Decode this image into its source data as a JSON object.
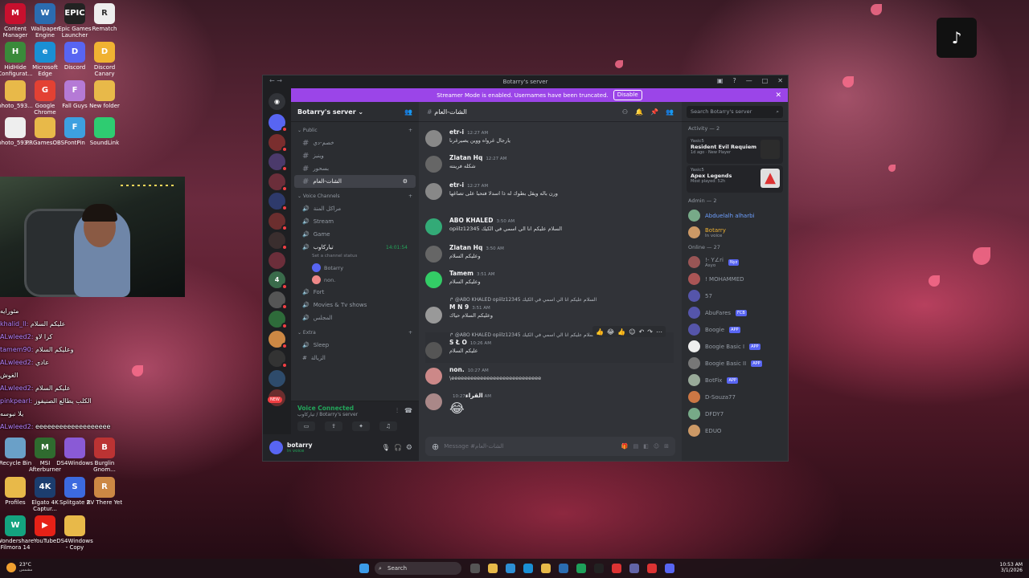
{
  "desktop": {
    "icons_top": [
      {
        "label": "Content Manager",
        "color": "#c8102e",
        "glyph": "M"
      },
      {
        "label": "Wallpaper Engine",
        "color": "#2b6cb0",
        "glyph": "W"
      },
      {
        "label": "Epic Games Launcher",
        "color": "#222",
        "glyph": "EPIC"
      },
      {
        "label": "Rematch",
        "color": "#eee",
        "glyph": "R"
      }
    ],
    "icons_row2": [
      {
        "label": "HidHide Configurat...",
        "color": "#3a8a3a",
        "glyph": "H"
      },
      {
        "label": "Microsoft Edge",
        "color": "#1a8fd4",
        "glyph": "e"
      },
      {
        "label": "Discord",
        "color": "#5865f2",
        "glyph": "D"
      },
      {
        "label": "Discord Canary",
        "color": "#f0b232",
        "glyph": "D"
      }
    ],
    "icons_row3": [
      {
        "label": "photo_593...",
        "color": "#e8b949",
        "glyph": ""
      },
      {
        "label": "Google Chrome",
        "color": "#e34133",
        "glyph": "G"
      },
      {
        "label": "Fall Guys",
        "color": "#b57ad6",
        "glyph": "F"
      },
      {
        "label": "New folder",
        "color": "#e8b949",
        "glyph": ""
      }
    ],
    "icons_row4": [
      {
        "label": "photo_593...",
        "color": "#eee",
        "glyph": ""
      },
      {
        "label": "PRGamesOBS",
        "color": "#e8b949",
        "glyph": ""
      },
      {
        "label": "FontPin",
        "color": "#3da0e0",
        "glyph": "F"
      },
      {
        "label": "SoundLink",
        "color": "#2ecc71",
        "glyph": ""
      }
    ],
    "icons_bottom": [
      {
        "label": "Recycle Bin",
        "color": "#6aa0c8",
        "glyph": ""
      },
      {
        "label": "MSI Afterburner",
        "color": "#2f6b2f",
        "glyph": "M"
      },
      {
        "label": "DS4Windows",
        "color": "#8a5ad6",
        "glyph": ""
      },
      {
        "label": "Burglin Gnom...",
        "color": "#b33",
        "glyph": "B"
      }
    ],
    "icons_bottom2": [
      {
        "label": "Profiles",
        "color": "#e8b949",
        "glyph": ""
      },
      {
        "label": "Elgato 4K Captur...",
        "color": "#1c3d6e",
        "glyph": "4K"
      },
      {
        "label": "Splitgate 2",
        "color": "#3c6adf",
        "glyph": "S"
      },
      {
        "label": "RV There Yet",
        "color": "#c84",
        "glyph": "R"
      }
    ],
    "icons_bottom3": [
      {
        "label": "Wondershare Filmora 14",
        "color": "#14a37f",
        "glyph": "W"
      },
      {
        "label": "YouTube",
        "color": "#e62117",
        "glyph": "▶"
      },
      {
        "label": "DS4Windows - Copy",
        "color": "#e8b949",
        "glyph": ""
      }
    ]
  },
  "stream_chat": [
    {
      "user": "",
      "text": "مثورايه"
    },
    {
      "user": "khalid_ll",
      "text": "عليكم السلام"
    },
    {
      "user": "ALwleed2",
      "text": "كرا لاو"
    },
    {
      "user": "tamem90",
      "text": "وعليكم السلام"
    },
    {
      "user": "ALwleed2",
      "text": "عادي"
    },
    {
      "user": "",
      "text": "الغوش"
    },
    {
      "user": "ALwleed2",
      "text": "عليكم السلام"
    },
    {
      "user": "pinkpearl",
      "text": "الكلب يطالع الصنيفوز"
    },
    {
      "user": "",
      "text": "يلا نبوسه"
    },
    {
      "user": "ALwleed2",
      "text": "eeeeeeeeeeeeeeeeeee"
    }
  ],
  "discord": {
    "window_title": "Botarry's server",
    "banner": {
      "text": "Streamer Mode is enabled. Usernames have been truncated.",
      "button": "Disable"
    },
    "server_name": "Botarry's server",
    "categories": {
      "public": "Public",
      "voice": "Voice Channels",
      "extra": "Extra"
    },
    "text_channels": [
      "خصم‑دي",
      "وينيز",
      "بسحور",
      "الشات‑العام"
    ],
    "voice_channels": [
      "مراكل المنة",
      "Stream",
      "Game",
      "تياركاوب",
      "Fort",
      "Movies & Tv shows",
      "المجلس"
    ],
    "voice_timer": "14:01:54",
    "voice_status_placeholder": "Set a channel status",
    "voice_users": [
      "Botarry",
      "non."
    ],
    "extra_channels": [
      "Sleep",
      "الزيالة"
    ],
    "new_badge": "NEW",
    "voice_connected": {
      "title": "Voice Connected",
      "subtitle": "تياركاوب / Botarry's server"
    },
    "user": {
      "name": "botarry",
      "status": "In voice"
    },
    "chat_channel": "الشات‑العام",
    "messages": [
      {
        "author": "etr‑i",
        "time": "12:27 AM",
        "text": "يارجال غرواه ووين يصيرغرنا",
        "reply": ""
      },
      {
        "author": "Zlatan Hq",
        "time": "12:27 AM",
        "text": "شكله فرينته",
        "reply": ""
      },
      {
        "author": "etr‑i",
        "time": "12:27 AM",
        "text": "ورن باله ويقل بطوك له ذا اسدلا فتحبا على تصاغها",
        "reply": ""
      },
      {
        "author": "ABO KHALED",
        "time": "3:50 AM",
        "text": "opiilz12345 السلام عليكم انا الي اسمي في الكيك",
        "reply": ""
      },
      {
        "author": "Zlatan Hq",
        "time": "3:50 AM",
        "text": "وعليكم السلام",
        "reply": ""
      },
      {
        "author": "Tamem",
        "time": "3:51 AM",
        "text": "وعليكم السلام",
        "reply": ""
      },
      {
        "author": "M N 9",
        "time": "3:51 AM",
        "text": "وعليكم السلام حياك",
        "reply": "@ABO KHALED opiilz12345 السلام عليكم انا الي اسمي في الكيك"
      },
      {
        "author": "S Ł O",
        "time": "10:26 AM",
        "text": "عليكم السلام",
        "reply": "@ABO KHALED opiilz12345 السلام عليكم انا الي اسمي في الكيك"
      },
      {
        "author": "non.",
        "time": "10:27 AM",
        "text": "\\eeeeeeeeeeeeeeeeeeeeeeeeeeee",
        "reply": ""
      },
      {
        "author": "القراء",
        "time": "10:27 AM",
        "text": "😂",
        "reply": ""
      }
    ],
    "composer_placeholder": "Message #الشات‑العام",
    "member_search_placeholder": "Search Botarry's server",
    "activity_header": "Activity — 2",
    "activities": [
      {
        "who": "Yasic5",
        "game": "Resident Evil Requiem",
        "meta": "1d ago · New Player"
      },
      {
        "who": "Yasic5",
        "game": "Apex Legends",
        "meta": "Most played: 52h"
      }
    ],
    "admin_header": "Admin — 2",
    "admins": [
      {
        "name": "Abduelalh alharbi",
        "sub": ""
      },
      {
        "name": "Botarry",
        "sub": "In voice"
      }
    ],
    "online_header": "Online — 27",
    "online": [
      {
        "name": "!- Y∠ri",
        "tag": "Nyz",
        "sub": "Asyo"
      },
      {
        "name": "! MOHAMMED",
        "tag": "",
        "sub": ""
      },
      {
        "name": "57",
        "tag": "",
        "sub": ""
      },
      {
        "name": "AbuFares",
        "tag": "FCB",
        "sub": ""
      },
      {
        "name": "Boogie",
        "tag": "APP",
        "sub": ""
      },
      {
        "name": "Boogie Basic I",
        "tag": "APP",
        "sub": ""
      },
      {
        "name": "Boogie Basic II",
        "tag": "APP",
        "sub": ""
      },
      {
        "name": "BotFix",
        "tag": "APP",
        "sub": ""
      },
      {
        "name": "D-Souza77",
        "tag": "",
        "sub": ""
      },
      {
        "name": "DFDY7",
        "tag": "",
        "sub": ""
      },
      {
        "name": "EDUO",
        "tag": "",
        "sub": ""
      }
    ]
  },
  "taskbar": {
    "weather_temp": "23°C",
    "weather_desc": "مشمس",
    "search_placeholder": "Search",
    "time": "10:53 AM",
    "date": "3/1/2026"
  }
}
